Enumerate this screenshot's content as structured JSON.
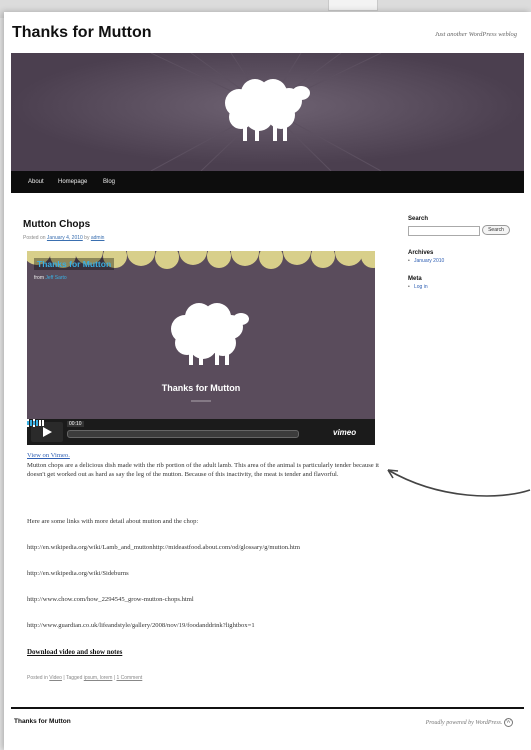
{
  "site": {
    "title": "Thanks for Mutton",
    "tagline": "Just another WordPress weblog"
  },
  "nav": {
    "items": [
      "About",
      "Homepage",
      "Blog"
    ]
  },
  "post": {
    "title": "Mutton Chops",
    "meta_prefix": "Posted on",
    "meta_date": "January 4, 2010",
    "meta_by": "by",
    "meta_author": "admin",
    "view_link": "View on Vimeo.",
    "paragraph1": "Mutton chops are a delicious dish made with the rib portion of the adult lamb. This area of the animal is particularly tender because it doesn't get worked out as hard as say the leg of the mutton. Because of this inactivity, the meat is tender and flavorful.",
    "paragraph2": "Here are some links with more detail about mutton and the chop:",
    "urls": [
      "http://en.wikipedia.org/wiki/Lamb_and_muttonhttp://mideastfood.about.com/od/glossary/g/mutton.htm",
      "http://en.wikipedia.org/wiki/Sideburns",
      "http://www.chow.com/how_2294545_grow-mutton-chops.html",
      "http://www.guardian.co.uk/lifeandstyle/gallery/2008/nov/19/foodanddrink?lightbox=1"
    ],
    "download_link": "Download video and show notes",
    "posted_in_prefix": "Posted in",
    "category": "Video",
    "tagged_prefix": "Tagged",
    "tags": "ipsum, lorem",
    "comments": "1 Comment"
  },
  "video": {
    "title": "Thanks for Mutton",
    "from_label": "from",
    "author": "Jeff Sarto",
    "center_title": "Thanks for Mutton",
    "timecode": "00:10",
    "logo": "vimeo",
    "progress_fraction": 0.0
  },
  "sidebar": {
    "search_title": "Search",
    "search_button": "Search",
    "search_value": "",
    "archives_title": "Archives",
    "archives": [
      "January 2010"
    ],
    "meta_title": "Meta",
    "meta_links": [
      "Log in"
    ]
  },
  "footer": {
    "title": "Thanks for Mutton",
    "credit": "Proudly powered by WordPress."
  },
  "colors": {
    "banner_bg": "#4b3f4f",
    "video_bg": "#5a4c5c",
    "link": "#2f5fb3",
    "video_title": "#3ab0e2"
  }
}
